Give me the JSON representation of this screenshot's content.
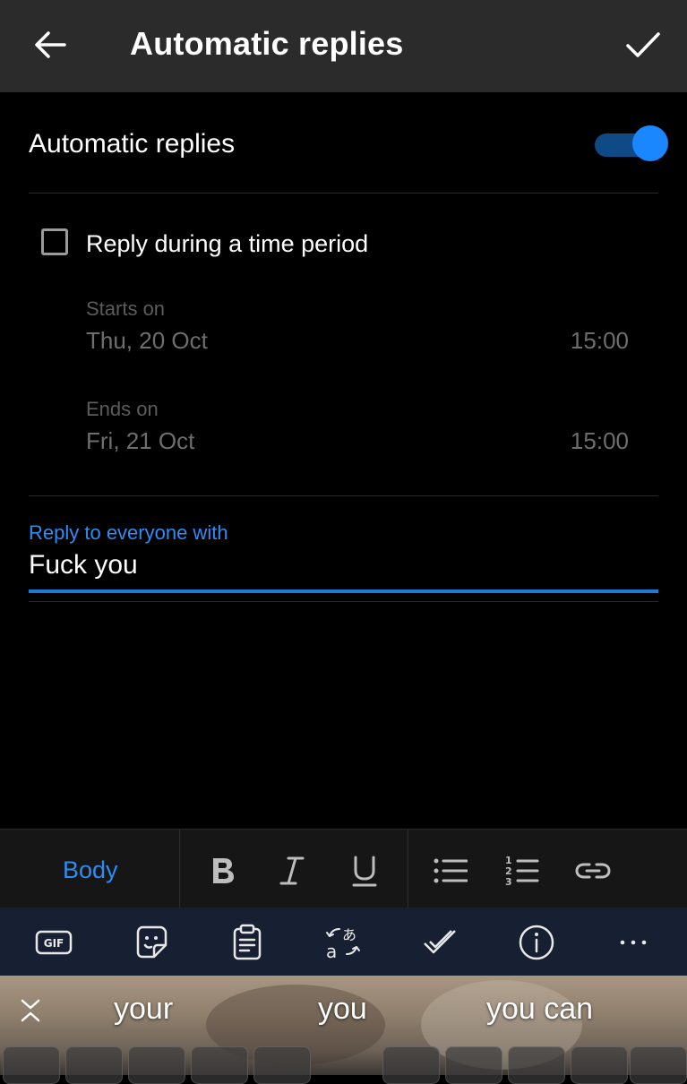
{
  "appbar": {
    "title": "Automatic replies",
    "back_icon": "arrow-left-icon",
    "confirm_icon": "checkmark-icon"
  },
  "automatic": {
    "label": "Automatic replies",
    "enabled": true,
    "accent": "#1a86ff"
  },
  "time_period": {
    "checkbox_label": "Reply during a time period",
    "checked": false,
    "starts": {
      "caption": "Starts on",
      "date": "Thu, 20 Oct",
      "time": "15:00"
    },
    "ends": {
      "caption": "Ends on",
      "date": "Fri, 21 Oct",
      "time": "15:00"
    }
  },
  "reply": {
    "label": "Reply to everyone with",
    "value": "Fuck you",
    "label_color": "#2f8cf5"
  },
  "format_toolbar": {
    "style_label": "Body",
    "icons": [
      "bold-icon",
      "italic-icon",
      "underline-icon",
      "bulleted-list-icon",
      "numbered-list-icon",
      "link-icon"
    ]
  },
  "keyboard_toolbar": {
    "icons": [
      "gif-icon",
      "sticker-icon",
      "clipboard-icon",
      "translate-icon",
      "spellcheck-icon",
      "info-icon",
      "more-icon"
    ],
    "gif_text": "GIF"
  },
  "suggestions": {
    "words": [
      "your",
      "you",
      "you can"
    ],
    "collapse_icon": "collapse-icon"
  }
}
